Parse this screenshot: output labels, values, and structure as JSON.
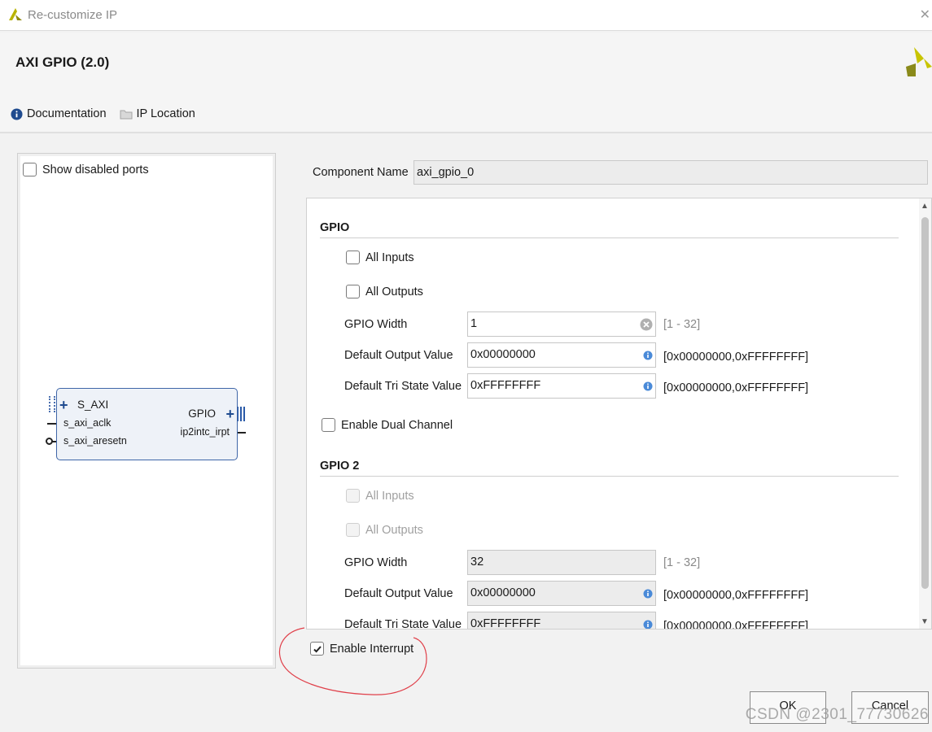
{
  "window": {
    "title": "Re-customize IP",
    "close_glyph": "✕"
  },
  "header": {
    "ip_title": "AXI GPIO (2.0)",
    "links": [
      {
        "label": "Documentation",
        "icon": "info-icon"
      },
      {
        "label": "IP Location",
        "icon": "folder-icon"
      }
    ]
  },
  "left_panel": {
    "show_disabled_ports": {
      "label": "Show disabled ports",
      "checked": false
    },
    "block": {
      "ports_left": [
        "S_AXI",
        "s_axi_aclk",
        "s_axi_aresetn"
      ],
      "ports_right": [
        "GPIO",
        "ip2intc_irpt"
      ]
    }
  },
  "component": {
    "label": "Component Name",
    "value": "axi_gpio_0"
  },
  "gpio": {
    "title": "GPIO",
    "all_inputs": {
      "label": "All Inputs",
      "checked": false
    },
    "all_outputs": {
      "label": "All Outputs",
      "checked": false
    },
    "width": {
      "label": "GPIO Width",
      "value": "1",
      "range": "[1 - 32]"
    },
    "default_output": {
      "label": "Default Output Value",
      "value": "0x00000000",
      "range": "[0x00000000,0xFFFFFFFF]"
    },
    "default_tri": {
      "label": "Default Tri State Value",
      "value": "0xFFFFFFFF",
      "range": "[0x00000000,0xFFFFFFFF]"
    }
  },
  "dual_channel": {
    "label": "Enable Dual Channel",
    "checked": false
  },
  "gpio2": {
    "title": "GPIO 2",
    "all_inputs": {
      "label": "All Inputs",
      "checked": false
    },
    "all_outputs": {
      "label": "All Outputs",
      "checked": false
    },
    "width": {
      "label": "GPIO Width",
      "value": "32",
      "range": "[1 - 32]"
    },
    "default_output": {
      "label": "Default Output Value",
      "value": "0x00000000",
      "range": "[0x00000000,0xFFFFFFFF]"
    },
    "default_tri": {
      "label": "Default Tri State Value",
      "value": "0xFFFFFFFF",
      "range": "[0x00000000,0xFFFFFFFF]"
    }
  },
  "enable_interrupt": {
    "label": "Enable Interrupt",
    "checked": true
  },
  "buttons": {
    "ok": "OK",
    "cancel": "Cancel"
  },
  "watermark": "CSDN @2301_77730626",
  "colors": {
    "brand_yellow": "#c8c400",
    "brand_dark": "#8a8a1a",
    "port_blue": "#1f4b8f",
    "annotation_red": "#e0404a"
  }
}
